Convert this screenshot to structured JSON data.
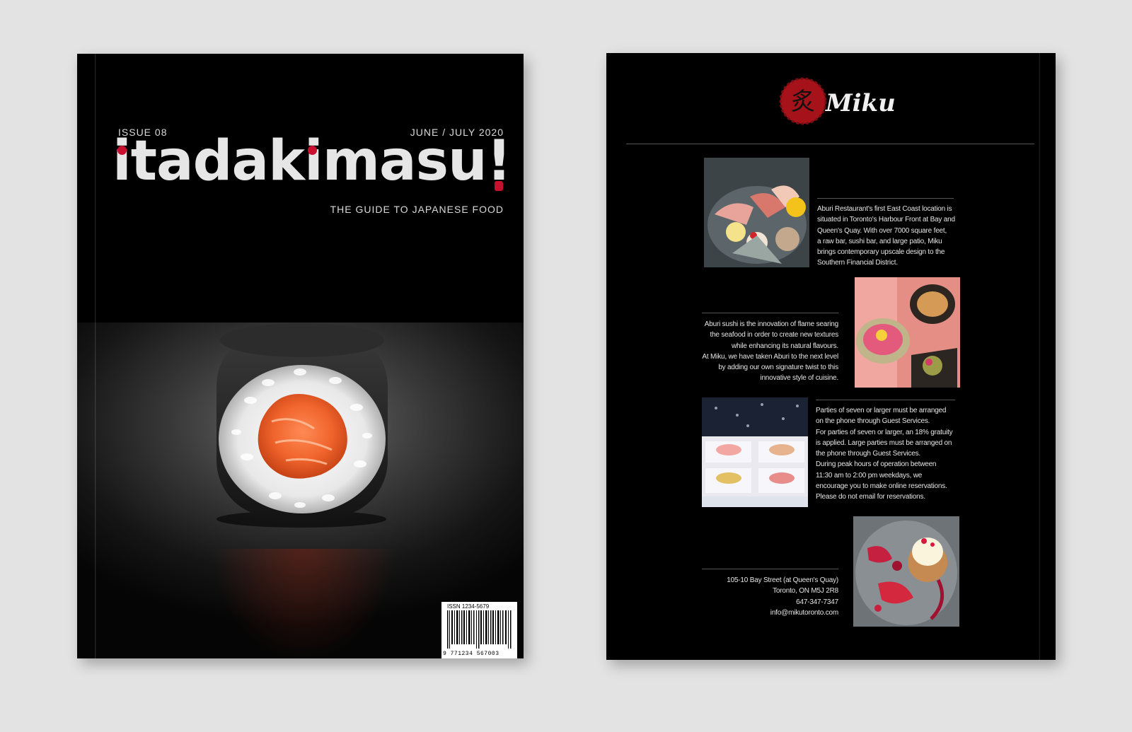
{
  "front_cover": {
    "issue": "ISSUE 08",
    "date": "JUNE / JULY 2020",
    "title": "itadakimasu!",
    "tagline": "THE GUIDE TO JAPANESE FOOD",
    "issn": "ISSN 1234-5679",
    "barcode_digits": "9  771234  567003",
    "accent_color": "#c8102e"
  },
  "back_page": {
    "logo_text": "Miku",
    "logo_kanji": "炙",
    "paragraph1": [
      "Aburi Restaurant's first East Coast location is",
      "situated in Toronto's Harbour Front at Bay and",
      "Queen's Quay. With over 7000 square feet,",
      "a raw bar, sushi bar, and large patio, Miku",
      "brings contemporary upscale design to the",
      "Southern Financial District."
    ],
    "paragraph2": [
      "Aburi sushi is the innovation of flame searing",
      "the seafood in order to create new textures",
      "while enhancing its natural flavours.",
      "At Miku, we have taken Aburi to the next level",
      "by adding our own signature twist to this",
      "innovative style of cuisine."
    ],
    "paragraph3": [
      "Parties of seven or larger must be arranged",
      "on the phone through Guest Services.",
      "For parties of seven or larger, an 18% gratuity",
      "is applied. Large parties must be arranged on",
      "the phone through Guest Services.",
      "During peak hours of operation between",
      "11:30 am to 2:00 pm weekdays, we",
      "encourage you to make online reservations.",
      "Please do not email for reservations."
    ],
    "address": [
      "105-10 Bay Street (at Queen's Quay)",
      "Toronto, ON M5J 2R8",
      "647-347-7347",
      "info@mikutoronto.com"
    ],
    "photos": [
      "sashimi-platter",
      "bento-box",
      "nigiri-tray",
      "dessert-plate"
    ]
  }
}
